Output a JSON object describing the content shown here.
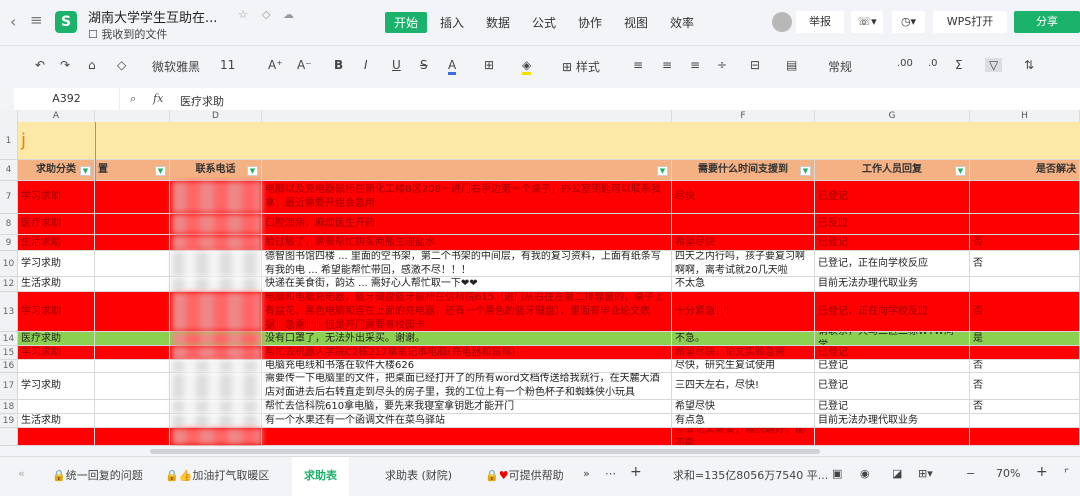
{
  "header": {
    "title": "湖南大学学生互助在...",
    "folder": "我收到的文件",
    "menus": [
      "开始",
      "插入",
      "数据",
      "公式",
      "协作",
      "视图",
      "效率"
    ],
    "report": "举报",
    "wps_open": "WPS打开",
    "share": "分享"
  },
  "toolbar": {
    "font": "微软雅黑",
    "size": "11",
    "style": "样式",
    "format": "常规"
  },
  "formula": {
    "cell": "A392",
    "fx": "fx",
    "value": "医疗求助"
  },
  "columns": [
    "A",
    "D",
    "F",
    "G",
    "H"
  ],
  "row1": {
    "num": "1",
    "text": "j"
  },
  "headers": {
    "num": "4",
    "a": "求助分类",
    "c": "置",
    "d": "联系电话",
    "e": "",
    "f": "需要什么时间支援到",
    "g": "工作人员回复",
    "h": "是否解决"
  },
  "rows": [
    {
      "num": "7",
      "cls": "red",
      "a": "学习求助",
      "e": "电脑以及充电器鼠标在新化工楼B区208一进门右手边第一个桌子，办公室钥匙可以联系我拿，最近需要开组会急用",
      "f": "尽快",
      "g": "已登记",
      "h": ""
    },
    {
      "num": "8",
      "cls": "red",
      "a": "医疗求助",
      "e": "口腔溃疡，麻烦医生开药",
      "f": "",
      "g": "已反应",
      "h": ""
    },
    {
      "num": "9",
      "cls": "red",
      "a": "生活求助",
      "e": "脸过敏了，需要帮忙购买两瓶生理盐水",
      "f": "希望尽快",
      "g": "已登记",
      "h": "否"
    },
    {
      "num": "10",
      "cls": "white",
      "a": "学习求助",
      "e": "德智图书馆四楼 ... 里面的空书架，第二个书架的中间层，有我的复习资料，上面有纸条写有我的电 ... 希望能帮忙带回，感激不尽！！！",
      "f": "四天之内行吗，孩子要复习啊啊啊，离考试就20几天啦",
      "g": "已登记，正在向学校反应",
      "h": "否"
    },
    {
      "num": "12",
      "cls": "white",
      "a": "生活求助",
      "e": "快递在美食街，韵达 ... 需好心人帮忙取一下❤❤",
      "f": "不太急",
      "g": "目前无法办理代取业务",
      "h": ""
    },
    {
      "num": "13",
      "cls": "red",
      "a": "学习求助",
      "e": "电脑和电脑充电器，蓝牙键盘蓝牙鼠标在信科院615（进门从右往左第二排靠窗的，桌子上有盆花，黑色电脑和连在上面的充电器，还有一个黑色的蓝牙键盘），里面有毕业论文数据！急需！！但是开门需要有校园卡",
      "f": "十分紧急！！",
      "g": "已登记，正在向学校反应",
      "h": "否"
    },
    {
      "num": "14",
      "cls": "green",
      "a": "医疗求助",
      "e": "没有口罩了，无法外出采买。谢谢。",
      "f": "不急。",
      "g": "请联系，天马二区二栋WYW同学，",
      "h": "是"
    },
    {
      "num": "15",
      "cls": "red",
      "a": "学习求助",
      "e": "帮忙去机器人学院C2栋217拿笔记本电脑(充电器和鼠标)",
      "f": "希望尽快，论文实验急需",
      "g": "已登记",
      "h": ""
    },
    {
      "num": "16",
      "cls": "white",
      "a": "",
      "e": "电脑充电线和书落在软件大楼626",
      "f": "尽快，研究生复试使用",
      "g": "已登记",
      "h": "否"
    },
    {
      "num": "17",
      "cls": "white",
      "a": "学习求助",
      "e": "需要传一下电脑里的文件，把桌面已经打开了的所有word文档传送给我就行，在天麓大酒店对面进去后右转直走到尽头的房子里，我的工位上有一个粉色杯子和蜘蛛侠小玩具",
      "f": "三四天左右，尽快!",
      "g": "已登记",
      "h": "否"
    },
    {
      "num": "18",
      "cls": "white",
      "a": "",
      "e": "帮忙去信科院610拿电脑，要先来我寝室拿钥匙才能开门",
      "f": "希望尽快",
      "g": "已登记",
      "h": "否"
    },
    {
      "num": "19",
      "cls": "white",
      "a": "生活求助",
      "e": "有一个水果还有一个函调文件在菜鸟驿站",
      "f": "有点急",
      "g": "目前无法办理代取业务",
      "h": ""
    },
    {
      "num": "",
      "cls": "red",
      "a": "",
      "e": "",
      "f": "毕业论文需要，越快越好，能不能",
      "g": "",
      "h": ""
    }
  ],
  "sheets": [
    "统一回复的问题",
    "加油打气取暖区",
    "求助表",
    "求助表 (财院)",
    "可提供帮助"
  ],
  "status": {
    "sum": "求和=135亿8056万7540 平...",
    "zoom": "70%"
  }
}
